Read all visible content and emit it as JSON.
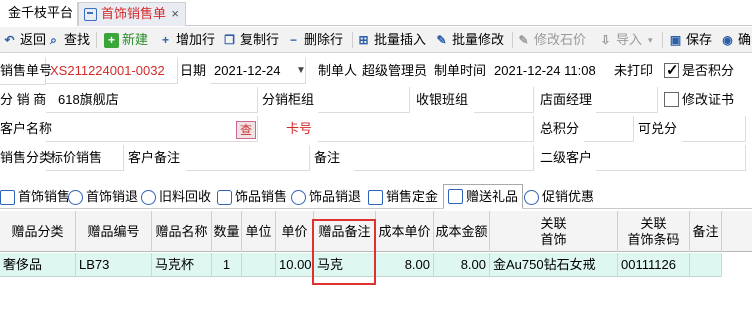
{
  "window_tabs": [
    {
      "label": "金千枝平台"
    },
    {
      "label": "首饰销售单",
      "close": "×"
    }
  ],
  "toolbar": {
    "back": "返回",
    "find": "查找",
    "new": "新建",
    "add_row": "增加行",
    "copy_row": "复制行",
    "delete_row": "删除行",
    "batch_insert": "批量插入",
    "batch_edit": "批量修改",
    "edit_stone_price": "修改石价",
    "import": "导入",
    "save": "保存",
    "confirm": "确"
  },
  "form": {
    "sale_no_label": "销售单号",
    "sale_no": "XS211224001-0032",
    "date_label": "日期",
    "date": "2021-12-24",
    "maker_label": "制单人",
    "maker": "超级管理员",
    "make_time_label": "制单时间",
    "make_time": "2021-12-24 11:08",
    "print_status": "未打印",
    "points_label": "是否积分",
    "store_label": "分 销 商",
    "store": "618旗舰店",
    "counter_label": "分销柜组",
    "cashier_label": "收银班组",
    "manager_label": "店面经理",
    "edit_cert_label": "修改证书",
    "customer_label": "客户名称",
    "query_btn": "查",
    "card_label": "卡号",
    "total_points_label": "总积分",
    "redeem_label": "可兑分",
    "category_label": "销售分类",
    "category": "标价销售",
    "customer_note_label": "客户备注",
    "note_label": "备注",
    "second_customer_label": "二级客户"
  },
  "section_tabs": [
    {
      "label": "首饰销售"
    },
    {
      "label": "首饰销退"
    },
    {
      "label": "旧料回收"
    },
    {
      "label": "饰品销售"
    },
    {
      "label": "饰品销退"
    },
    {
      "label": "销售定金"
    },
    {
      "label": "赠送礼品"
    },
    {
      "label": "促销优惠"
    }
  ],
  "grid": {
    "headers": [
      "赠品分类",
      "赠品编号",
      "赠品名称",
      "数量",
      "单位",
      "单价",
      "赠品备注",
      "成本单价",
      "成本金额",
      "关联\n首饰",
      "关联\n首饰条码",
      "备注"
    ],
    "rows": [
      [
        "奢侈品",
        "LB73",
        "马克杯",
        "1",
        "",
        "10.00",
        "马克",
        "8.00",
        "8.00",
        "金Au750钻石女戒",
        "00111126",
        ""
      ]
    ]
  }
}
